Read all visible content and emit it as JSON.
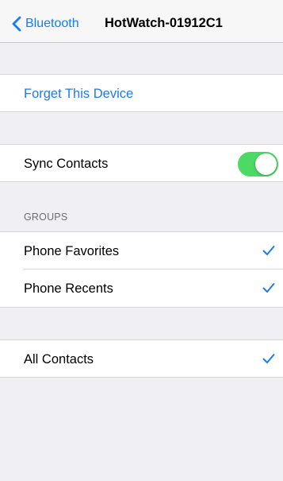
{
  "navbar": {
    "back_label": "Bluetooth",
    "title": "HotWatch-01912C1"
  },
  "forget": {
    "label": "Forget This Device"
  },
  "sync": {
    "label": "Sync Contacts",
    "enabled": true
  },
  "groups": {
    "header": "GROUPS",
    "items": [
      {
        "label": "Phone Favorites",
        "checked": true
      },
      {
        "label": "Phone Recents",
        "checked": true
      }
    ]
  },
  "all_contacts": {
    "label": "All Contacts",
    "checked": true
  },
  "colors": {
    "accent": "#1a7cf0",
    "toggle_on": "#4cd964",
    "background": "#efeff4"
  }
}
